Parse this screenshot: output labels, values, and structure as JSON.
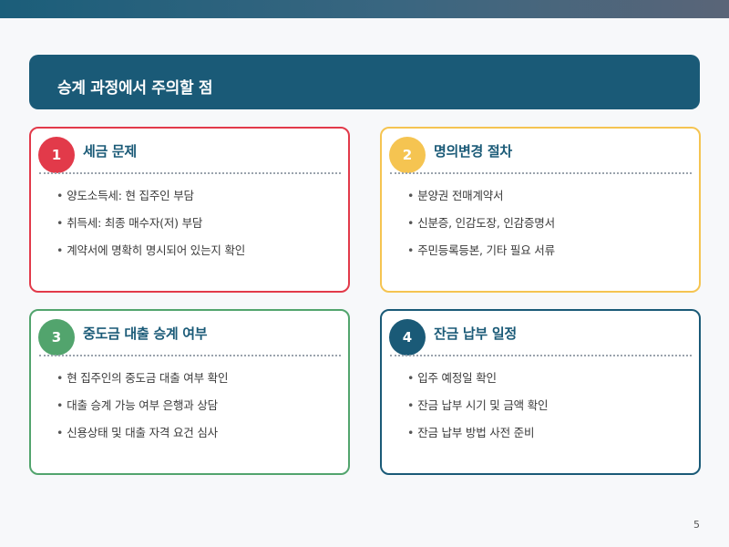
{
  "title": "승계 과정에서 주의할 점",
  "page_number": "5",
  "cards": [
    {
      "number": "1",
      "title": "세금 문제",
      "color": "#e23a4a",
      "items": [
        "양도소득세: 현 집주인 부담",
        "취득세: 최종 매수자(저) 부담",
        "계약서에 명확히 명시되어 있는지 확인"
      ]
    },
    {
      "number": "2",
      "title": "명의변경 절차",
      "color": "#f5c451",
      "items": [
        "분양권 전매계약서",
        "신분증, 인감도장, 인감증명서",
        "주민등록등본, 기타 필요 서류"
      ]
    },
    {
      "number": "3",
      "title": "중도금 대출 승계 여부",
      "color": "#52a46d",
      "items": [
        "현 집주인의 중도금 대출 여부 확인",
        "대출 승계 가능 여부 은행과 상담",
        "신용상태 및 대출 자격 요건 심사"
      ]
    },
    {
      "number": "4",
      "title": "잔금 납부 일정",
      "color": "#1a5a77",
      "items": [
        "입주 예정일 확인",
        "잔금 납부 시기 및 금액 확인",
        "잔금 납부 방법 사전 준비"
      ]
    }
  ]
}
